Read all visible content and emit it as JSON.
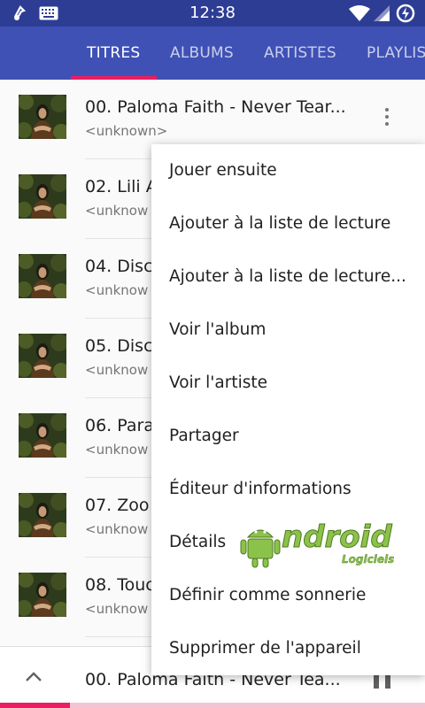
{
  "status_bar": {
    "time": "12:38",
    "icons": [
      "music-note-icon",
      "keyboard-icon",
      "wifi-icon",
      "signal-icon",
      "battery-icon"
    ]
  },
  "tabs": [
    {
      "label": "TITRES",
      "active": true
    },
    {
      "label": "ALBUMS",
      "active": false
    },
    {
      "label": "ARTISTES",
      "active": false
    },
    {
      "label": "PLAYLIS",
      "active": false
    }
  ],
  "tracks": [
    {
      "title": "00. Paloma Faith - Never Tear...",
      "artist": "<unknown>"
    },
    {
      "title": "02. Lili A",
      "artist": "<unknow"
    },
    {
      "title": "04. Disc",
      "artist": "<unknow"
    },
    {
      "title": "05. Disc",
      "artist": "<unknow"
    },
    {
      "title": "06. Para",
      "artist": "<unknow"
    },
    {
      "title": "07. Zoo",
      "artist": "<unknow"
    },
    {
      "title": "08. Touc",
      "artist": "<unknow"
    }
  ],
  "context_menu": {
    "items": [
      "Jouer ensuite",
      "Ajouter à la liste de lecture",
      "Ajouter à la liste de lecture...",
      "Voir l'album",
      "Voir l'artiste",
      "Partager",
      "Éditeur d'informations",
      "Détails",
      "Définir comme sonnerie",
      "Supprimer de l'appareil"
    ]
  },
  "watermark": {
    "brand": "ndroid",
    "sub": "Logiciels"
  },
  "player": {
    "title": "00. Paloma Faith - Never Tea...",
    "progress": 0.165
  },
  "colors": {
    "primary": "#3f51b5",
    "status": "#2e3d94",
    "accent": "#e91e63"
  }
}
